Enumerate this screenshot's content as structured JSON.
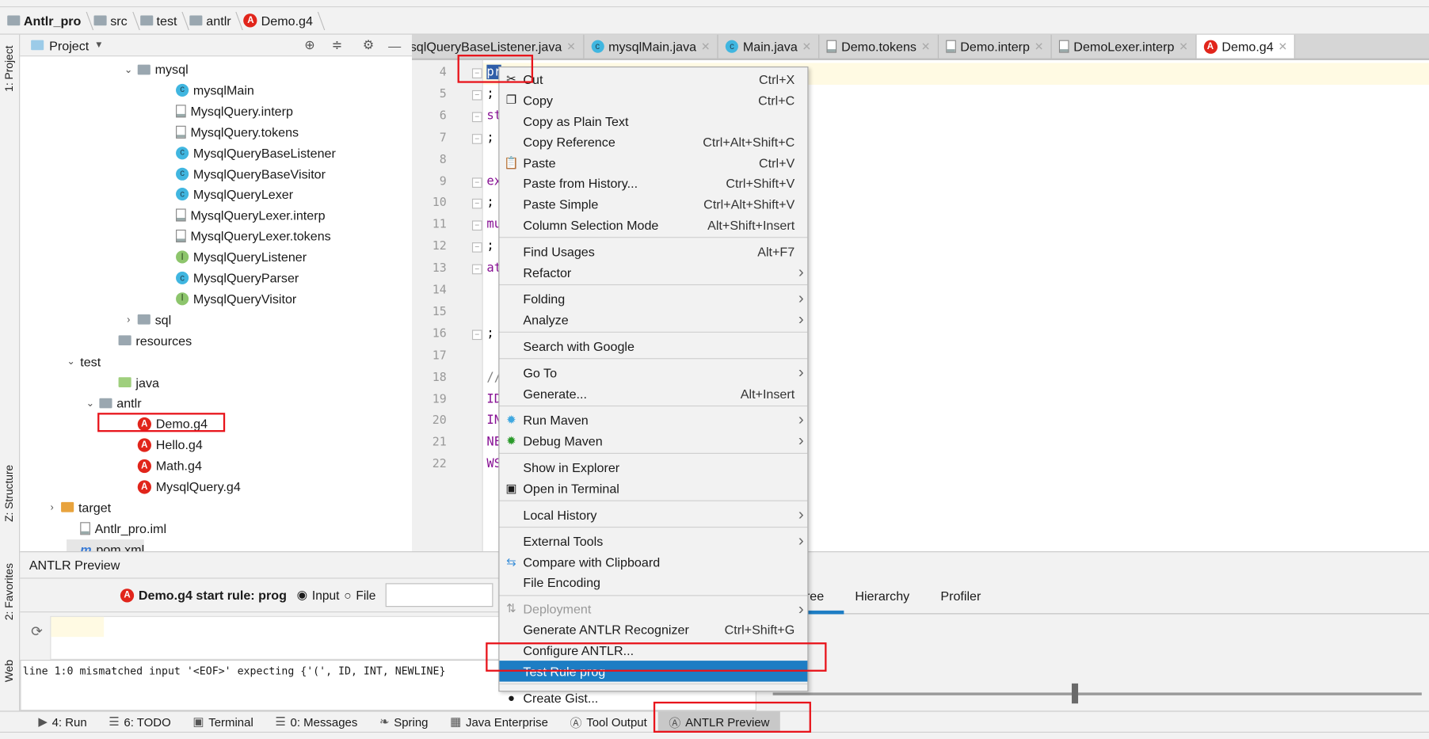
{
  "breadcrumb": [
    "Antlr_pro",
    "src",
    "test",
    "antlr",
    "Demo.g4"
  ],
  "left_strip": {
    "project": "1: Project",
    "structure": "Z: Structure",
    "favorites": "2: Favorites",
    "web": "Web"
  },
  "project_panel": {
    "title": "Project"
  },
  "tree": [
    {
      "label": "mysql",
      "icon": "folder",
      "indent": 2,
      "chevron": "down"
    },
    {
      "label": "mysqlMain",
      "icon": "class",
      "indent": 3
    },
    {
      "label": "MysqlQuery.interp",
      "icon": "file",
      "indent": 3
    },
    {
      "label": "MysqlQuery.tokens",
      "icon": "file",
      "indent": 3
    },
    {
      "label": "MysqlQueryBaseListener",
      "icon": "class",
      "indent": 3
    },
    {
      "label": "MysqlQueryBaseVisitor",
      "icon": "class",
      "indent": 3
    },
    {
      "label": "MysqlQueryLexer",
      "icon": "class",
      "indent": 3
    },
    {
      "label": "MysqlQueryLexer.interp",
      "icon": "file",
      "indent": 3
    },
    {
      "label": "MysqlQueryLexer.tokens",
      "icon": "file",
      "indent": 3
    },
    {
      "label": "MysqlQueryListener",
      "icon": "interface",
      "indent": 3
    },
    {
      "label": "MysqlQueryParser",
      "icon": "class",
      "indent": 3
    },
    {
      "label": "MysqlQueryVisitor",
      "icon": "interface",
      "indent": 3
    },
    {
      "label": "sql",
      "icon": "folder",
      "indent": 2,
      "chevron": "right"
    },
    {
      "label": "resources",
      "icon": "folder",
      "indent": 1.5
    },
    {
      "label": "test",
      "icon": "none",
      "indent": 0.5,
      "chevron": "down"
    },
    {
      "label": "java",
      "icon": "folder-green",
      "indent": 1.5
    },
    {
      "label": "antlr",
      "icon": "folder",
      "indent": 1,
      "chevron": "down"
    },
    {
      "label": "Demo.g4",
      "icon": "antlr",
      "indent": 2
    },
    {
      "label": "Hello.g4",
      "icon": "antlr",
      "indent": 2
    },
    {
      "label": "Math.g4",
      "icon": "antlr",
      "indent": 2
    },
    {
      "label": "MysqlQuery.g4",
      "icon": "antlr",
      "indent": 2
    },
    {
      "label": "target",
      "icon": "folder-orange",
      "indent": 0,
      "chevron": "right"
    },
    {
      "label": "Antlr_pro.iml",
      "icon": "file",
      "indent": 0.5
    },
    {
      "label": "pom.xml",
      "icon": "maven",
      "indent": 0.5
    }
  ],
  "editor_tabs": [
    {
      "label": "sqlQueryBaseListener.java",
      "icon": "none"
    },
    {
      "label": "mysqlMain.java",
      "icon": "class"
    },
    {
      "label": "Main.java",
      "icon": "class"
    },
    {
      "label": "Demo.tokens",
      "icon": "file"
    },
    {
      "label": "Demo.interp",
      "icon": "file"
    },
    {
      "label": "DemoLexer.interp",
      "icon": "file"
    },
    {
      "label": "Demo.g4",
      "icon": "antlr",
      "active": true
    }
  ],
  "code_lines": [
    {
      "n": "4",
      "text": "pr",
      "fold": true
    },
    {
      "n": "5",
      "text": ";",
      "fold": true
    },
    {
      "n": "6",
      "text": "st",
      "fold": true
    },
    {
      "n": "7",
      "text": ";",
      "fold": true
    },
    {
      "n": "8",
      "text": ""
    },
    {
      "n": "9",
      "text": "ex",
      "fold": true
    },
    {
      "n": "10",
      "text": ";",
      "fold": true
    },
    {
      "n": "11",
      "text": "mu",
      "fold": true
    },
    {
      "n": "12",
      "text": ";",
      "fold": true
    },
    {
      "n": "13",
      "text": "at",
      "fold": true
    },
    {
      "n": "14",
      "text": ""
    },
    {
      "n": "15",
      "text": ""
    },
    {
      "n": "16",
      "text": ";",
      "fold": true
    },
    {
      "n": "17",
      "text": ""
    },
    {
      "n": "18",
      "text": "//"
    },
    {
      "n": "19",
      "text": "ID"
    },
    {
      "n": "20",
      "text": "IN"
    },
    {
      "n": "21",
      "text": "NE"
    },
    {
      "n": "22",
      "text": "WS"
    }
  ],
  "context_menu": [
    {
      "label": "Cut",
      "shortcut": "Ctrl+X",
      "icon": "scissors"
    },
    {
      "label": "Copy",
      "shortcut": "Ctrl+C",
      "icon": "copy"
    },
    {
      "label": "Copy as Plain Text"
    },
    {
      "label": "Copy Reference",
      "shortcut": "Ctrl+Alt+Shift+C"
    },
    {
      "label": "Paste",
      "shortcut": "Ctrl+V",
      "icon": "clipboard"
    },
    {
      "label": "Paste from History...",
      "shortcut": "Ctrl+Shift+V"
    },
    {
      "label": "Paste Simple",
      "shortcut": "Ctrl+Alt+Shift+V"
    },
    {
      "label": "Column Selection Mode",
      "shortcut": "Alt+Shift+Insert"
    },
    {
      "sep": true
    },
    {
      "label": "Find Usages",
      "shortcut": "Alt+F7"
    },
    {
      "label": "Refactor",
      "submenu": true
    },
    {
      "sep": true
    },
    {
      "label": "Folding",
      "submenu": true
    },
    {
      "label": "Analyze",
      "submenu": true
    },
    {
      "sep": true
    },
    {
      "label": "Search with Google"
    },
    {
      "sep": true
    },
    {
      "label": "Go To",
      "submenu": true
    },
    {
      "label": "Generate...",
      "shortcut": "Alt+Insert"
    },
    {
      "sep": true
    },
    {
      "label": "Run Maven",
      "submenu": true,
      "icon": "gear-blue"
    },
    {
      "label": "Debug Maven",
      "submenu": true,
      "icon": "gear-green"
    },
    {
      "sep": true
    },
    {
      "label": "Show in Explorer"
    },
    {
      "label": "Open in Terminal",
      "icon": "terminal"
    },
    {
      "sep": true
    },
    {
      "label": "Local History",
      "submenu": true
    },
    {
      "sep": true
    },
    {
      "label": "External Tools",
      "submenu": true
    },
    {
      "label": "Compare with Clipboard",
      "icon": "compare"
    },
    {
      "label": "File Encoding"
    },
    {
      "sep": true
    },
    {
      "label": "Deployment",
      "submenu": true,
      "disabled": true,
      "icon": "deploy"
    },
    {
      "label": "Generate ANTLR Recognizer",
      "shortcut": "Ctrl+Shift+G"
    },
    {
      "label": "Configure ANTLR..."
    },
    {
      "label": "Test Rule prog",
      "selected": true
    },
    {
      "sep": true
    },
    {
      "label": "Create Gist...",
      "icon": "github"
    }
  ],
  "antlr_preview": {
    "title": "ANTLR Preview",
    "start_rule": "Demo.g4 start rule: prog",
    "radio_input": "Input",
    "radio_file": "File",
    "selected_radio": "Input",
    "error": "line 1:0 mismatched input '<EOF>' expecting {'(', ID, INT, NEWLINE}",
    "tabs": [
      "tree",
      "Hierarchy",
      "Profiler"
    ],
    "active_tab": "tree"
  },
  "bottom_tools": [
    {
      "label": "4: Run",
      "icon": "play"
    },
    {
      "label": "6: TODO",
      "icon": "list"
    },
    {
      "label": "Terminal",
      "icon": "terminal"
    },
    {
      "label": "0: Messages",
      "icon": "messages"
    },
    {
      "label": "Spring",
      "icon": "leaf"
    },
    {
      "label": "Java Enterprise",
      "icon": "ee"
    },
    {
      "label": "Tool Output",
      "icon": "antlr-gray"
    },
    {
      "label": "ANTLR Preview",
      "icon": "antlr-gray",
      "active": true
    }
  ],
  "colors": {
    "accent": "#1d7dc4",
    "highlight_box": "#e8141b",
    "antlr": "#e1251b",
    "current_line": "#fffae3"
  }
}
